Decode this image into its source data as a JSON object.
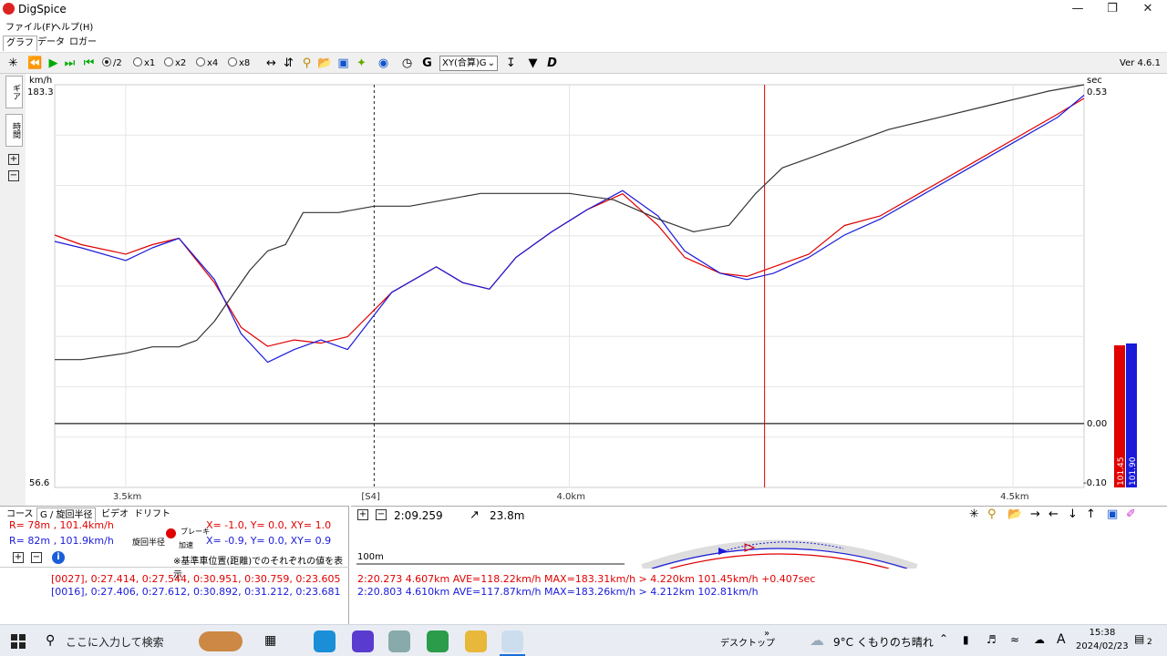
{
  "app": {
    "title": "DigSpice"
  },
  "menu": {
    "file": "ファイル(F)",
    "help": "ヘルプ(H)"
  },
  "tabs": [
    "グラフ",
    "データ",
    "ロガー"
  ],
  "toolbar": {
    "speeds": [
      "/2",
      "x1",
      "x2",
      "x4",
      "x8"
    ],
    "selected_speed": "/2",
    "xy_select": "XY(合算)G",
    "version": "Ver 4.6.1"
  },
  "side_tabs": [
    "ギア",
    "時間"
  ],
  "chart_data": {
    "type": "line",
    "left_axis": {
      "unit": "km/h",
      "max": "183.3",
      "min": "56.6"
    },
    "right_axis": {
      "unit": "sec",
      "max": "0.53",
      "zero": "0.00",
      "min": "-0.10"
    },
    "x_ticks": [
      "3.5km",
      "[S4]",
      "4.0km",
      "4.5km"
    ],
    "x_range_km": [
      3.42,
      4.58
    ],
    "series": [
      {
        "name": "",
        "color": "#e00000",
        "kind": "speed",
        "unit": "km/h",
        "x": [
          3.42,
          3.45,
          3.5,
          3.53,
          3.56,
          3.6,
          3.63,
          3.66,
          3.69,
          3.72,
          3.75,
          3.8,
          3.85,
          3.88,
          3.91,
          3.94,
          3.98,
          4.02,
          4.06,
          4.1,
          4.13,
          4.17,
          4.2,
          4.23,
          4.27,
          4.31,
          4.35,
          4.4,
          4.45,
          4.5,
          4.55,
          4.58
        ],
        "values": [
          136,
          133,
          130,
          133,
          135,
          121,
          107,
          101,
          103,
          102,
          104,
          118,
          126,
          121,
          119,
          129,
          137,
          144,
          149,
          139,
          129,
          124,
          123,
          126,
          130,
          139,
          142,
          150,
          158,
          166,
          174,
          179
        ]
      },
      {
        "name": "",
        "color": "#1a1adb",
        "kind": "speed",
        "unit": "km/h",
        "x": [
          3.42,
          3.45,
          3.5,
          3.53,
          3.56,
          3.6,
          3.63,
          3.66,
          3.69,
          3.72,
          3.75,
          3.8,
          3.85,
          3.88,
          3.91,
          3.94,
          3.98,
          4.02,
          4.06,
          4.1,
          4.13,
          4.17,
          4.2,
          4.23,
          4.27,
          4.31,
          4.35,
          4.4,
          4.45,
          4.5,
          4.55,
          4.58
        ],
        "values": [
          134,
          132,
          128,
          132,
          135,
          122,
          105,
          96,
          100,
          103,
          100,
          118,
          126,
          121,
          119,
          129,
          137,
          144,
          150,
          142,
          131,
          124,
          122,
          124,
          129,
          136,
          141,
          149,
          157,
          165,
          173,
          180
        ]
      },
      {
        "name": "",
        "color": "#333333",
        "kind": "time-delta",
        "unit": "sec",
        "x": [
          3.42,
          3.45,
          3.5,
          3.53,
          3.56,
          3.58,
          3.6,
          3.62,
          3.64,
          3.66,
          3.68,
          3.7,
          3.74,
          3.78,
          3.82,
          3.86,
          3.9,
          3.95,
          4.0,
          4.05,
          4.1,
          4.14,
          4.18,
          4.21,
          4.24,
          4.3,
          4.36,
          4.42,
          4.48,
          4.54,
          4.58
        ],
        "values": [
          0.1,
          0.1,
          0.11,
          0.12,
          0.12,
          0.13,
          0.16,
          0.2,
          0.24,
          0.27,
          0.28,
          0.33,
          0.33,
          0.34,
          0.34,
          0.35,
          0.36,
          0.36,
          0.36,
          0.35,
          0.32,
          0.3,
          0.31,
          0.36,
          0.4,
          0.43,
          0.46,
          0.48,
          0.5,
          0.52,
          0.53
        ]
      }
    ],
    "cursor_dashed_km": 3.78,
    "cursor_red_km": 4.22,
    "bars": {
      "red_label": "101.45",
      "blue_label": "101.90"
    }
  },
  "bottom_left": {
    "tabs": [
      "コース",
      "G / 旋回半径",
      "ビデオ",
      "ドリフト"
    ],
    "red_row": "R=  78m , 101.4km/h",
    "red_row_xy": "X= -1.0,  Y=   0.0,  XY= 1.0",
    "blue_row": "R=  82m , 101.9km/h",
    "blue_row_xy": "X= -0.9,  Y=   0.0,  XY= 0.9",
    "label_turn": "旋回半径",
    "label_brake": "ブレーキ",
    "label_accel": "加速",
    "note": "※基準車位置(距離)でのそれぞれの値を表示",
    "red_laps": "[0027], 0:27.414, 0:27.544, 0:30.951, 0:30.759, 0:23.605",
    "blue_laps": "[0016], 0:27.406, 0:27.612, 0:30.892, 0:31.212, 0:23.681"
  },
  "bottom_right": {
    "lap_time": "2:09.259",
    "distance": "23.8m",
    "scale": "100m",
    "red_summary": "2:20.273 4.607km AVE=118.22km/h MAX=183.31km/h > 4.220km 101.45km/h +0.407sec",
    "blue_summary": "2:20.803 4.610km AVE=117.87km/h MAX=183.26km/h > 4.212km 102.81km/h"
  },
  "taskbar": {
    "search_placeholder": "ここに入力して検索",
    "desktop": "デスクトップ",
    "weather": "9°C  くもりのち晴れ",
    "ime": "A",
    "time": "15:38",
    "date": "2024/02/23",
    "notifications": "2"
  }
}
